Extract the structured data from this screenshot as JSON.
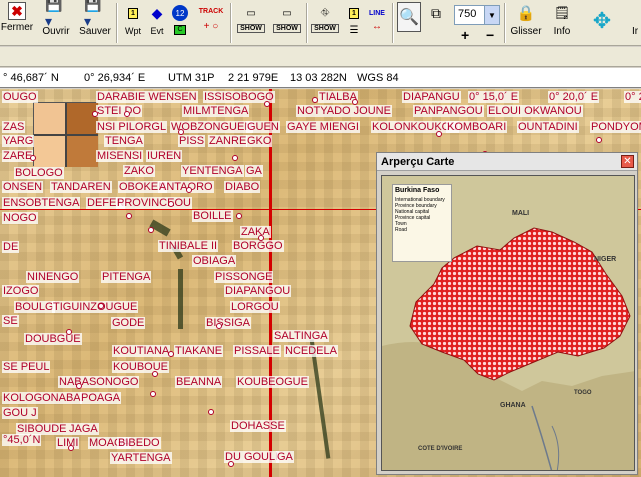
{
  "toolbar": {
    "fermer": "Fermer",
    "ouvrir": "Ouvrir",
    "sauver": "Sauver",
    "wpt": "Wpt",
    "evt": "Evt",
    "num12": "12",
    "track": "TRACK",
    "show1": "SHOW",
    "show2": "SHOW",
    "show3": "SHOW",
    "line": "LINE",
    "zoom": "750",
    "glisser": "Glisser",
    "info": "Info",
    "more": "Ir"
  },
  "coords": {
    "lat": "° 46,687´ N",
    "lon": "0° 26,934´ E",
    "utm": "UTM  31P",
    "east": "2 21 979E",
    "north": "13 03 282N",
    "datum": "WGS 84"
  },
  "map_labels": [
    "OUGO",
    "DARABIE WENSEN",
    "ISSISOBOGO",
    "TIALBA",
    "DIAPANGU",
    "0° 15,0´ E",
    "0° 20,0´ E",
    "0° 25",
    "STEI DO",
    "MILMTENGA",
    "NOTYADO JOUNE",
    "PANPANGOU",
    "ELOUI OKWANOU",
    "ZAS",
    "NSI PILORGL",
    "WOBZONGUEN",
    "GUEN",
    "GAYE MIENGI",
    "KOLONKOUKOU",
    "KOMBOARI",
    "OUNTADINI",
    "PONDYOM",
    "YARG",
    "TENGA",
    "PISS",
    "ZANRE",
    "GKO",
    "MISENSI",
    "IUREN",
    "ZARE",
    "BOLOGO",
    "ZAKO",
    "YENTENGA",
    "GA",
    "ONSEN",
    "TANDAREN",
    "OBOKEN",
    "ANTAORO",
    "DIABO",
    "ENSOBTENGA",
    "DEFEN",
    "PROVINCEOU",
    "BOILLE",
    "NOGO",
    "ZAKA",
    "TINIBALE II",
    "BORGGO",
    "DE",
    "OBIAGA",
    "NINENGO",
    "PITENGA",
    "PISSONGE",
    "IZOGO",
    "DIAPANGOU",
    "BOULG",
    "TIGUINZOUGUE",
    "LORGOU",
    "SE",
    "GODE",
    "BISSIGA",
    "DOUBGUE",
    "SALTINGA",
    "KOUTIANA",
    "TIAKANE",
    "PISSALE",
    "NCEDELA",
    "SE PEUL",
    "KOUBOUE",
    "NABASONOGO",
    "BEANNA",
    "KOUBEOGUE",
    "KOLOGONABA",
    "POAGA",
    "GOU J",
    "SIBOUDE",
    "JAGA",
    "DOHASSE",
    "°45,0´N",
    "LIMI",
    "MOAGA",
    "BIBEDO",
    "YARTENGA",
    "DU GOULI",
    "GA"
  ],
  "overview": {
    "title": "Arperçu Carte",
    "map_title": "Burkina Faso",
    "countries": [
      "MALI",
      "NIGER",
      "GHANA",
      "TOGO",
      "COTE D'IVOIRE"
    ],
    "legend": [
      "International boundary",
      "Province boundary",
      "National capital",
      "Province capital",
      "Town",
      "Road"
    ]
  },
  "colors": {
    "label_red": "#b0002a",
    "line_red": "#d40000",
    "map_bg": "#dcb978"
  }
}
